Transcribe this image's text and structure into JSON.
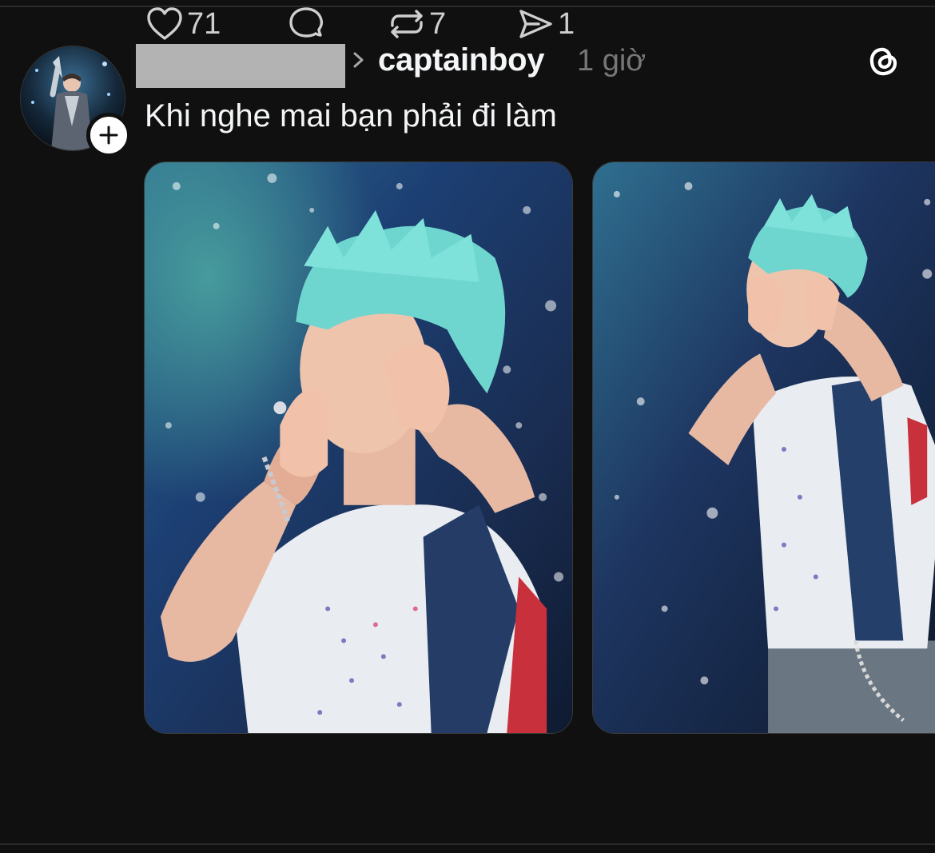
{
  "post": {
    "username": "captainboy",
    "time": "1 giờ",
    "caption": "Khi nghe mai bạn phải đi làm",
    "images": [
      "photo-1",
      "photo-2"
    ]
  },
  "actions": {
    "likes": "71",
    "replies": "",
    "reposts": "7",
    "shares": "1"
  },
  "icons": {
    "follow": "plus-icon",
    "brand": "threads-logo-icon",
    "like": "heart-icon",
    "reply": "speech-bubble-icon",
    "repost": "repost-icon",
    "share": "send-icon",
    "chevron": "chevron-right-icon"
  },
  "colors": {
    "background": "#101010",
    "text": "#f3f5f7",
    "muted": "#777777",
    "hair": "#6fd6cf"
  }
}
